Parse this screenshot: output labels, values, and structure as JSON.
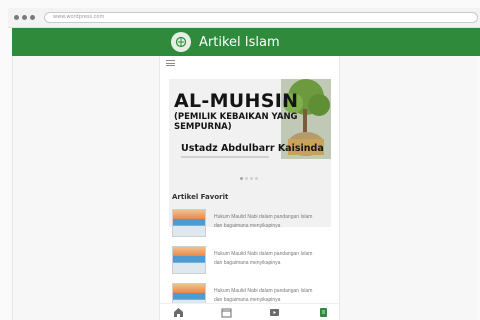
{
  "browser": {
    "url": "www.wordpress.com"
  },
  "header": {
    "title": "Artikel Islam",
    "logo_icon": "book-globe-icon",
    "color": "#2f8a3b"
  },
  "banner": {
    "heading": "AL-MUHSIN",
    "subheading": "(PEMILIK KEBAIKAN YANG SEMPURNA)",
    "speaker": "Ustadz Abdulbarr Kaisinda"
  },
  "section": {
    "title": "Artikel Favorit"
  },
  "articles": [
    {
      "title": "Hukum Maulid Nabi dalam pandangan Islam dan bagaimana menyikapinya"
    },
    {
      "title": "Hukum Maulid Nabi dalam pandangan Islam dan bagaimana menyikapinya"
    },
    {
      "title": "Hukum Maulid Nabi dalam pandangan Islam dan bagaimana menyikapinya"
    }
  ],
  "bottom_nav": [
    {
      "name": "home-icon"
    },
    {
      "name": "calendar-icon"
    },
    {
      "name": "video-icon"
    },
    {
      "name": "book-icon",
      "active": true
    }
  ]
}
